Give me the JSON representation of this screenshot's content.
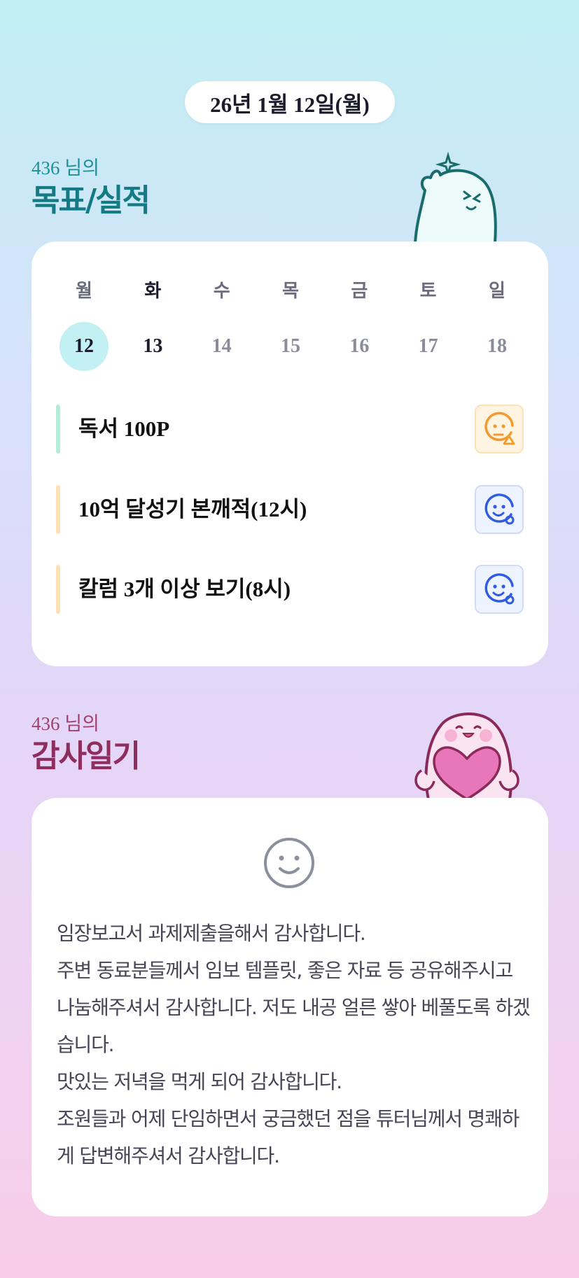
{
  "date_label": "26년 1월 12일(월)",
  "goals_section": {
    "subtitle": "436 님의",
    "title": "목표/실적",
    "weekdays": [
      "월",
      "화",
      "수",
      "목",
      "금",
      "토",
      "일"
    ],
    "dates": [
      "12",
      "13",
      "14",
      "15",
      "16",
      "17",
      "18"
    ],
    "items": [
      {
        "label": "독서 100P",
        "bar_color": "#b5ecd7",
        "status_icon": "meh-face-warning-icon"
      },
      {
        "label": "10억 달성기 본깨적(12시)",
        "bar_color": "#fde0b6",
        "status_icon": "smile-face-dot-icon"
      },
      {
        "label": "칼럼 3개 이상 보기(8시)",
        "bar_color": "#fde0b6",
        "status_icon": "smile-face-dot-icon"
      }
    ]
  },
  "diary_section": {
    "subtitle": "436 님의",
    "title": "감사일기",
    "mood_icon": "smile-face-icon",
    "text": "임장보고서 과제제출을해서 감사합니다.\n주변 동료분들께서 임보 템플릿, 좋은 자료 등 공유해주시고 나눔해주셔서 감사합니다. 저도 내공 얼른 쌓아 베풀도록 하겠습니다.\n맛있는 저녁을 먹게 되어 감사합니다.\n조원들과 어제 단임하면서 궁금했던 점을 튜터님께서 명쾌하게 답변해주셔서 감사합니다."
  },
  "colors": {
    "teal_title": "#147b84",
    "plum_title": "#8e2e5f",
    "today_highlight": "#c3f0f3",
    "warning_orange": "#f29a2e",
    "status_blue": "#2f5be0"
  }
}
